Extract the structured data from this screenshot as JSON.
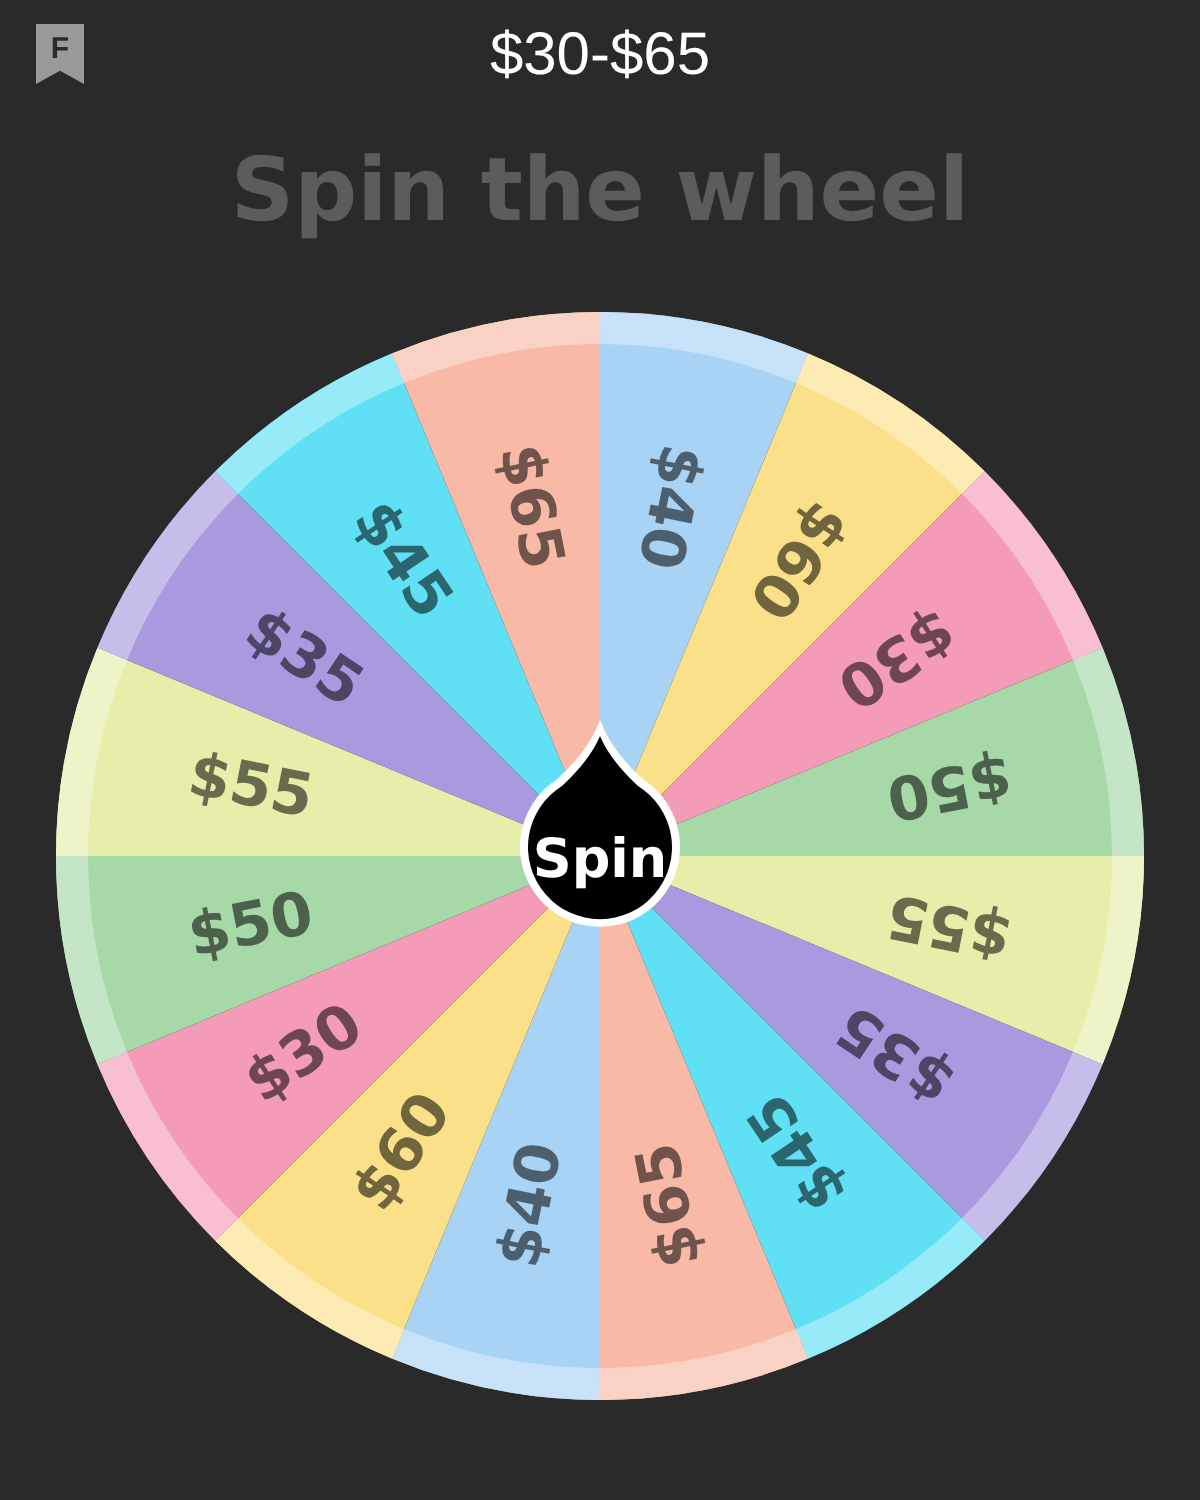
{
  "header": {
    "badge": "F",
    "title": "$30-$65"
  },
  "heading": "Spin the wheel",
  "wheel": {
    "spin_label": "Spin",
    "segments": [
      {
        "label": "$40",
        "color": "#a9d3f4"
      },
      {
        "label": "$60",
        "color": "#fbe08a"
      },
      {
        "label": "$30",
        "color": "#f49bb8"
      },
      {
        "label": "$50",
        "color": "#a6d8a8"
      },
      {
        "label": "$55",
        "color": "#e7eeaa"
      },
      {
        "label": "$35",
        "color": "#a99ae0"
      },
      {
        "label": "$45",
        "color": "#5fe0f4"
      },
      {
        "label": "$65",
        "color": "#f8b9a6"
      },
      {
        "label": "$40",
        "color": "#a9d3f4"
      },
      {
        "label": "$60",
        "color": "#fbe08a"
      },
      {
        "label": "$30",
        "color": "#f49bb8"
      },
      {
        "label": "$50",
        "color": "#a6d8a8"
      },
      {
        "label": "$55",
        "color": "#e7eeaa"
      },
      {
        "label": "$35",
        "color": "#a99ae0"
      },
      {
        "label": "$45",
        "color": "#5fe0f4"
      },
      {
        "label": "$65",
        "color": "#f8b9a6"
      }
    ]
  }
}
